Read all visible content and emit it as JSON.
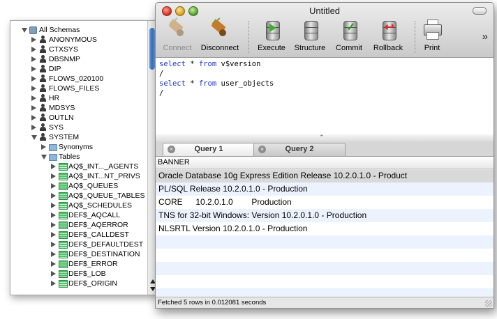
{
  "tree": {
    "items": [
      {
        "label": "All Schemas",
        "icon": "database-icon",
        "state": "expanded",
        "level": 0
      },
      {
        "label": "ANONYMOUS",
        "icon": "user-icon",
        "state": "collapsed",
        "level": 1
      },
      {
        "label": "CTXSYS",
        "icon": "user-icon",
        "state": "collapsed",
        "level": 1
      },
      {
        "label": "DBSNMP",
        "icon": "user-icon",
        "state": "collapsed",
        "level": 1
      },
      {
        "label": "DIP",
        "icon": "user-icon",
        "state": "collapsed",
        "level": 1
      },
      {
        "label": "FLOWS_020100",
        "icon": "user-icon",
        "state": "collapsed",
        "level": 1
      },
      {
        "label": "FLOWS_FILES",
        "icon": "user-icon",
        "state": "collapsed",
        "level": 1
      },
      {
        "label": "HR",
        "icon": "user-icon",
        "state": "collapsed",
        "level": 1
      },
      {
        "label": "MDSYS",
        "icon": "user-icon",
        "state": "collapsed",
        "level": 1
      },
      {
        "label": "OUTLN",
        "icon": "user-icon",
        "state": "collapsed",
        "level": 1
      },
      {
        "label": "SYS",
        "icon": "user-icon",
        "state": "collapsed",
        "level": 1
      },
      {
        "label": "SYSTEM",
        "icon": "user-icon",
        "state": "expanded",
        "level": 1
      },
      {
        "label": "Synonyms",
        "icon": "folder-icon",
        "state": "collapsed",
        "level": 2
      },
      {
        "label": "Tables",
        "icon": "folder-icon",
        "state": "expanded",
        "level": 2
      },
      {
        "label": "AQ$_INT..._AGENTS",
        "icon": "table-icon",
        "state": "collapsed",
        "level": 3
      },
      {
        "label": "AQ$_INT...NT_PRIVS",
        "icon": "table-icon",
        "state": "collapsed",
        "level": 3
      },
      {
        "label": "AQ$_QUEUES",
        "icon": "table-icon",
        "state": "collapsed",
        "level": 3
      },
      {
        "label": "AQ$_QUEUE_TABLES",
        "icon": "table-icon",
        "state": "collapsed",
        "level": 3
      },
      {
        "label": "AQ$_SCHEDULES",
        "icon": "table-icon",
        "state": "collapsed",
        "level": 3
      },
      {
        "label": "DEF$_AQCALL",
        "icon": "table-icon",
        "state": "collapsed",
        "level": 3
      },
      {
        "label": "DEF$_AQERROR",
        "icon": "table-icon",
        "state": "collapsed",
        "level": 3
      },
      {
        "label": "DEF$_CALLDEST",
        "icon": "table-icon",
        "state": "collapsed",
        "level": 3
      },
      {
        "label": "DEF$_DEFAULTDEST",
        "icon": "table-icon",
        "state": "collapsed",
        "level": 3
      },
      {
        "label": "DEF$_DESTINATION",
        "icon": "table-icon",
        "state": "collapsed",
        "level": 3
      },
      {
        "label": "DEF$_ERROR",
        "icon": "table-icon",
        "state": "collapsed",
        "level": 3
      },
      {
        "label": "DEF$_LOB",
        "icon": "table-icon",
        "state": "collapsed",
        "level": 3
      },
      {
        "label": "DEF$_ORIGIN",
        "icon": "table-icon",
        "state": "collapsed",
        "level": 3
      }
    ]
  },
  "window": {
    "title": "Untitled"
  },
  "toolbar": {
    "connect": "Connect",
    "disconnect": "Disconnect",
    "execute": "Execute",
    "structure": "Structure",
    "commit": "Commit",
    "rollback": "Rollback",
    "print": "Print",
    "overflow": "»"
  },
  "editor": {
    "lines": [
      [
        {
          "t": "select",
          "kw": true
        },
        {
          "t": " * ",
          "kw": false
        },
        {
          "t": "from",
          "kw": true
        },
        {
          "t": " v$version",
          "kw": false
        }
      ],
      [
        {
          "t": "/",
          "kw": false
        }
      ],
      [
        {
          "t": "select",
          "kw": true
        },
        {
          "t": " * ",
          "kw": false
        },
        {
          "t": "from",
          "kw": true
        },
        {
          "t": " user_objects",
          "kw": false
        }
      ],
      [
        {
          "t": "/",
          "kw": false
        }
      ]
    ]
  },
  "tabs": [
    {
      "label": "Query 1",
      "active": true
    },
    {
      "label": "Query 2",
      "active": false
    }
  ],
  "results": {
    "column": "BANNER",
    "rows": [
      "Oracle Database 10g Express Edition Release 10.2.0.1.0 - Product",
      "PL/SQL Release 10.2.0.1.0 - Production",
      "CORE\t10.2.0.1.0\tProduction",
      "TNS for 32-bit Windows: Version 10.2.0.1.0 - Production",
      "NLSRTL Version 10.2.0.1.0 - Production"
    ],
    "selected_row": 0
  },
  "status": {
    "text": "Fetched 5 rows in 0.012081 seconds"
  }
}
